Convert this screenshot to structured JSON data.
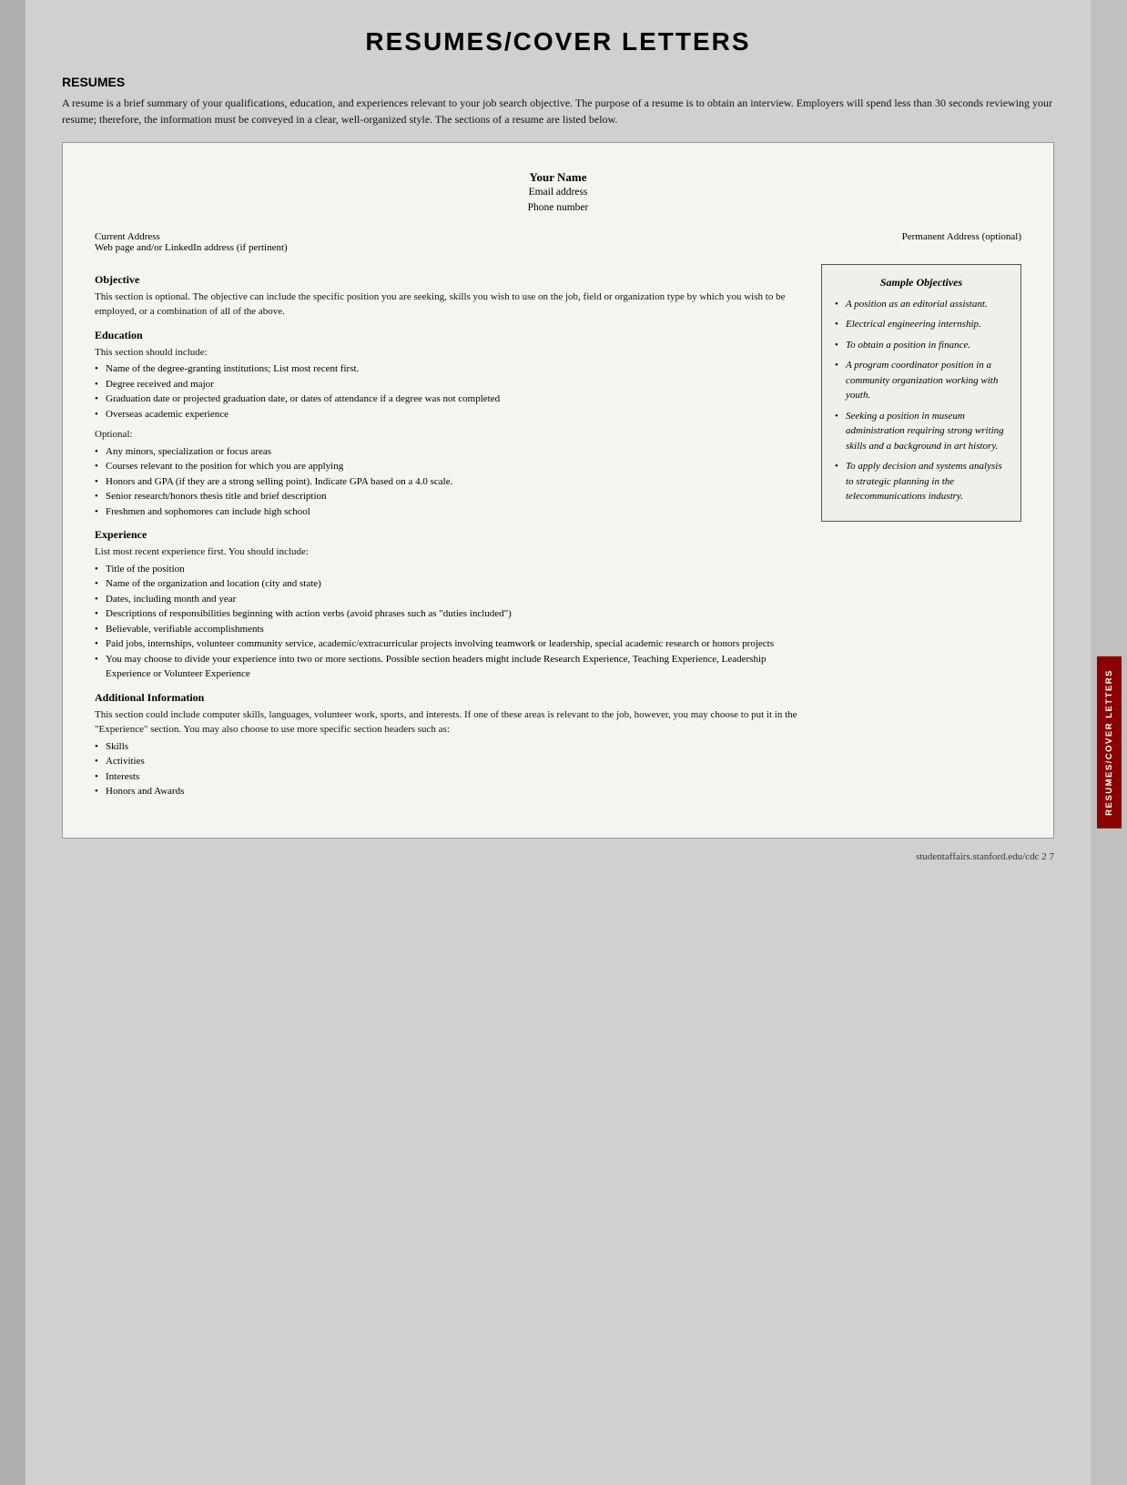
{
  "page": {
    "title": "RESUMES/COVER LETTERS",
    "footer": "studentaffairs.stanford.edu/cdc   2 7"
  },
  "resumes_section": {
    "heading": "RESUMES",
    "intro": "A resume is a brief summary of your qualifications, education, and experiences relevant to your job search objective. The purpose of a resume is to obtain an interview. Employers will spend less than 30 seconds reviewing your resume; therefore, the information must be conveyed in a clear, well-organized style. The sections of a resume are listed below."
  },
  "resume_template": {
    "name": "Your Name",
    "email": "Email address",
    "phone": "Phone number",
    "current_address": "Current Address",
    "web_address": "Web page and/or LinkedIn address (if pertinent)",
    "permanent_address": "Permanent Address (optional)",
    "objective_title": "Objective",
    "objective_text": "This section is optional. The objective can include the specific position you are seeking, skills you wish to use on the job, field or organization type by which you wish to be employed, or a combination of all of the above.",
    "education_title": "Education",
    "education_intro": "This section should include:",
    "education_bullets": [
      "Name of the degree-granting institutions; List most recent first.",
      "Degree received and major",
      "Graduation date or projected graduation date, or dates of attendance if a degree was not completed",
      "Overseas academic experience"
    ],
    "education_optional_label": "Optional:",
    "education_optional_bullets": [
      "Any minors, specialization or focus areas",
      "Courses relevant to the position for which you are applying",
      "Honors and GPA (if they are a strong selling point). Indicate GPA based on a 4.0 scale.",
      "Senior research/honors thesis title and brief description",
      "Freshmen and sophomores can include high school"
    ],
    "experience_title": "Experience",
    "experience_intro": "List most recent experience first. You should include:",
    "experience_bullets": [
      "Title of the position",
      "Name of the organization and location (city and state)",
      "Dates, including month and year",
      "Descriptions of responsibilities beginning with action verbs (avoid phrases such as \"duties included\")",
      "Believable, verifiable accomplishments",
      "Paid jobs, internships, volunteer community service, academic/extracurricular projects involving teamwork or leadership, special academic research or honors projects",
      "You may choose to divide your experience into two or more sections. Possible section headers might include Research Experience, Teaching Experience, Leadership Experience or Volunteer Experience"
    ],
    "additional_title": "Additional Information",
    "additional_text": "This section could include computer skills, languages, volunteer work, sports, and interests. If one of these areas is relevant to the job, however, you may choose to put it in the \"Experience\" section. You may also choose to use more specific section headers such as:",
    "additional_bullets": [
      "Skills",
      "Activities",
      "Interests",
      "Honors and Awards"
    ]
  },
  "sample_objectives": {
    "title": "Sample Objectives",
    "items": [
      "A position as an editorial assistant.",
      "Electrical engineering internship.",
      "To obtain a position in finance.",
      "A program coordinator position in a community organization working with youth.",
      "Seeking a position in museum administration requiring strong writing skills and a background in art history.",
      "To apply decision and systems analysis to strategic planning in the telecommunications industry."
    ]
  },
  "sidebar_label": "RESUMES/COVER LETTERS"
}
